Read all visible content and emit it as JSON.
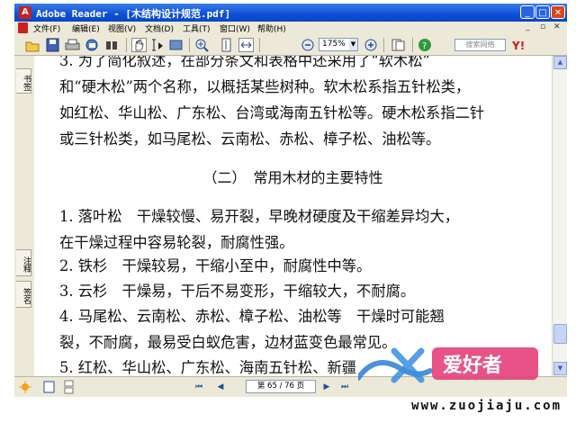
{
  "window": {
    "title": "Adobe Reader - [木结构设计规范.pdf]",
    "controls": {
      "minimize": "_",
      "maximize": "□",
      "close": "✕"
    }
  },
  "menubar": {
    "items": [
      "文件(F)",
      "编辑(E)",
      "视图(V)",
      "文档(D)",
      "工具(T)",
      "窗口(W)",
      "帮助(H)"
    ],
    "mdi_controls": [
      "_",
      "▫",
      "✕"
    ]
  },
  "toolbar": {
    "zoom_value": "175%",
    "search_placeholder": "搜索网络",
    "icons": [
      "open-icon",
      "save-icon",
      "print-icon",
      "email-icon",
      "find-icon",
      "hand-tool-icon",
      "select-text-icon",
      "snapshot-icon",
      "zoom-in-tool-icon",
      "fit-page-icon",
      "fit-width-icon",
      "zoom-out-icon",
      "zoom-in-icon",
      "pages-icon",
      "help-icon",
      "yahoo-icon"
    ]
  },
  "nav_tabs": [
    "书签",
    "注释",
    "签名"
  ],
  "document": {
    "lines": [
      "3.  为了简化叙述，在部分条文和表格中还采用了“软木松”",
      "和“硬木松”两个名称，以概括某些树种。软木松系指五针松类，",
      "如红松、华山松、广东松、台湾或海南五针松等。硬木松系指二针",
      "或三针松类，如马尾松、云南松、赤松、樟子松、油松等。"
    ],
    "heading": "（二）　常用木材的主要特性",
    "items": [
      "1. 落叶松　干燥较慢、易开裂，早晚材硬度及干缩差异均大，",
      "在干燥过程中容易轮裂，耐腐性强。",
      "2.  铁杉　干燥较易，干缩小至中，耐腐性中等。",
      "3.  云杉　干燥易，干后不易变形，干缩较大，不耐腐。",
      "4.  马尾松、云南松、赤松、樟子松、油松等　干燥时可能翘",
      "裂，不耐腐，最易受白蚁危害，边材蓝变色最常见。",
      "5.  红松、华山松、广东松、海南五针松、新疆"
    ]
  },
  "statusbar": {
    "page_indicator": "第 65 / 76 页",
    "nav": {
      "first": "⏮",
      "prev": "◀",
      "next": "▶",
      "last": "⏭"
    }
  },
  "watermark": {
    "logo_text": "爱好者",
    "url": "www.zuojiaju.com"
  },
  "colors": {
    "title_bar": "#0c4fd6",
    "chrome": "#ece9d8",
    "accent_red": "#c8201e",
    "watermark_pink": "#e5407a"
  }
}
